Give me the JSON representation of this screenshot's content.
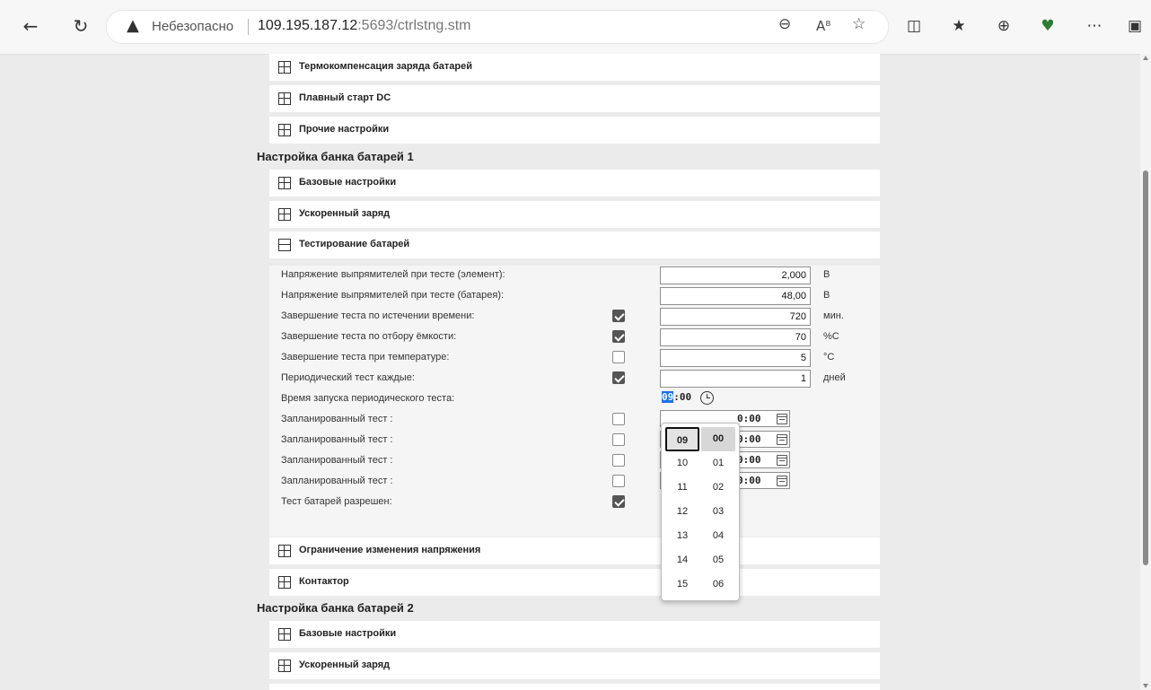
{
  "browser": {
    "back_icon": "back-arrow-icon",
    "reload_icon": "reload-icon",
    "security_warning": "Небезопасно",
    "url_host": "109.195.187.12",
    "url_rest": ":5693/ctrlstng.stm",
    "icons": [
      "zoom-out-icon",
      "read-aloud-icon",
      "favorite-star-icon",
      "split-screen-icon",
      "favorites-list-icon",
      "collections-icon",
      "health-icon",
      "more-icon",
      "sidebar-icon"
    ]
  },
  "top_panels": [
    {
      "label": "Термокомпенсация заряда батарей",
      "expanded": false
    },
    {
      "label": "Плавный старт DC",
      "expanded": false
    },
    {
      "label": "Прочие настройки",
      "expanded": false
    }
  ],
  "bank1": {
    "title": "Настройка банка батарей 1",
    "panels_before": [
      {
        "label": "Базовые настройки",
        "expanded": false
      },
      {
        "label": "Ускоренный заряд",
        "expanded": false
      },
      {
        "label": "Тестирование батарей",
        "expanded": true
      }
    ],
    "test_rows": [
      {
        "label": "Напряжение выпрямителей при тесте (элемент):",
        "value": "2,000",
        "unit": "В"
      },
      {
        "label": "Напряжение выпрямителей при тесте (батарея):",
        "value": "48,00",
        "unit": "В"
      },
      {
        "label": "Завершение теста по истечении времени:",
        "checked": true,
        "value": "720",
        "unit": "мин."
      },
      {
        "label": "Завершение теста по отбору ёмкости:",
        "checked": true,
        "value": "70",
        "unit": "%С"
      },
      {
        "label": "Завершение теста при температуре:",
        "checked": false,
        "value": "5",
        "unit": "°С"
      },
      {
        "label": "Периодический тест каждые:",
        "checked": true,
        "value": "1",
        "unit": "дней"
      }
    ],
    "start_time": {
      "label": "Время запуска периодического теста:",
      "hour": "09",
      "minute": "00"
    },
    "scheduled": [
      {
        "label": "Запланированный тест :",
        "checked": false,
        "time": "0:00"
      },
      {
        "label": "Запланированный тест :",
        "checked": false,
        "time": "0:00"
      },
      {
        "label": "Запланированный тест :",
        "checked": false,
        "time": "0:00"
      },
      {
        "label": "Запланированный тест :",
        "checked": false,
        "time": "0:00"
      }
    ],
    "test_allowed": {
      "label": "Тест батарей разрешен:",
      "checked": true
    },
    "panels_after": [
      {
        "label": "Ограничение изменения напряжения",
        "expanded": false
      },
      {
        "label": "Контактор",
        "expanded": false
      }
    ]
  },
  "bank2": {
    "title": "Настройка банка батарей 2",
    "panels": [
      {
        "label": "Базовые настройки",
        "expanded": false
      },
      {
        "label": "Ускоренный заряд",
        "expanded": false
      }
    ]
  },
  "time_picker": {
    "hours": [
      "09",
      "10",
      "11",
      "12",
      "13",
      "14",
      "15"
    ],
    "minutes": [
      "00",
      "01",
      "02",
      "03",
      "04",
      "05",
      "06"
    ],
    "selected_hour": "09",
    "selected_minute": "00"
  }
}
